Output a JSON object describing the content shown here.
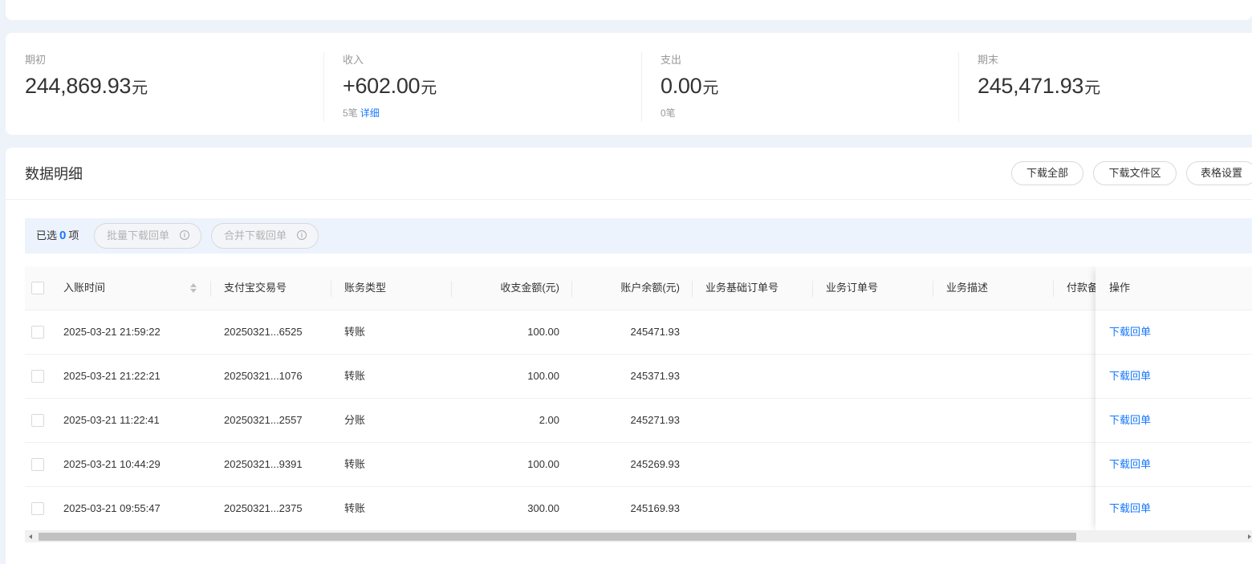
{
  "summary": {
    "opening": {
      "label": "期初",
      "amount": "244,869.93",
      "unit": "元"
    },
    "income": {
      "label": "收入",
      "amount": "+602.00",
      "unit": "元",
      "count": "5笔",
      "detail_link": "详细"
    },
    "expense": {
      "label": "支出",
      "amount": "0.00",
      "unit": "元",
      "count": "0笔"
    },
    "closing": {
      "label": "期末",
      "amount": "245,471.93",
      "unit": "元"
    }
  },
  "detail": {
    "title": "数据明细",
    "buttons": {
      "download_all": "下载全部",
      "download_area": "下载文件区",
      "table_settings": "表格设置"
    }
  },
  "selection": {
    "prefix": "已选",
    "count": "0",
    "suffix": "项",
    "batch_download": "批量下载回单",
    "merge_download": "合并下载回单",
    "info_glyph": "i"
  },
  "table": {
    "columns": {
      "time": "入账时间",
      "trade_no": "支付宝交易号",
      "type": "账务类型",
      "amount": "收支金额(元)",
      "balance": "账户余额(元)",
      "base_order": "业务基础订单号",
      "order": "业务订单号",
      "desc": "业务描述",
      "payer_note": "付款备",
      "action": "操作"
    },
    "rows": [
      {
        "time": "2025-03-21 21:59:22",
        "trade_no": "20250321...6525",
        "type": "转账",
        "amount": "100.00",
        "balance": "245471.93",
        "action": "下载回单"
      },
      {
        "time": "2025-03-21 21:22:21",
        "trade_no": "20250321...1076",
        "type": "转账",
        "amount": "100.00",
        "balance": "245371.93",
        "action": "下载回单"
      },
      {
        "time": "2025-03-21 11:22:41",
        "trade_no": "20250321...2557",
        "type": "分账",
        "amount": "2.00",
        "balance": "245271.93",
        "action": "下载回单"
      },
      {
        "time": "2025-03-21 10:44:29",
        "trade_no": "20250321...9391",
        "type": "转账",
        "amount": "100.00",
        "balance": "245269.93",
        "action": "下载回单"
      },
      {
        "time": "2025-03-21 09:55:47",
        "trade_no": "20250321...2375",
        "type": "转账",
        "amount": "300.00",
        "balance": "245169.93",
        "action": "下载回单"
      }
    ]
  },
  "colors": {
    "accent": "#1677ff",
    "background": "#eef2f9"
  }
}
